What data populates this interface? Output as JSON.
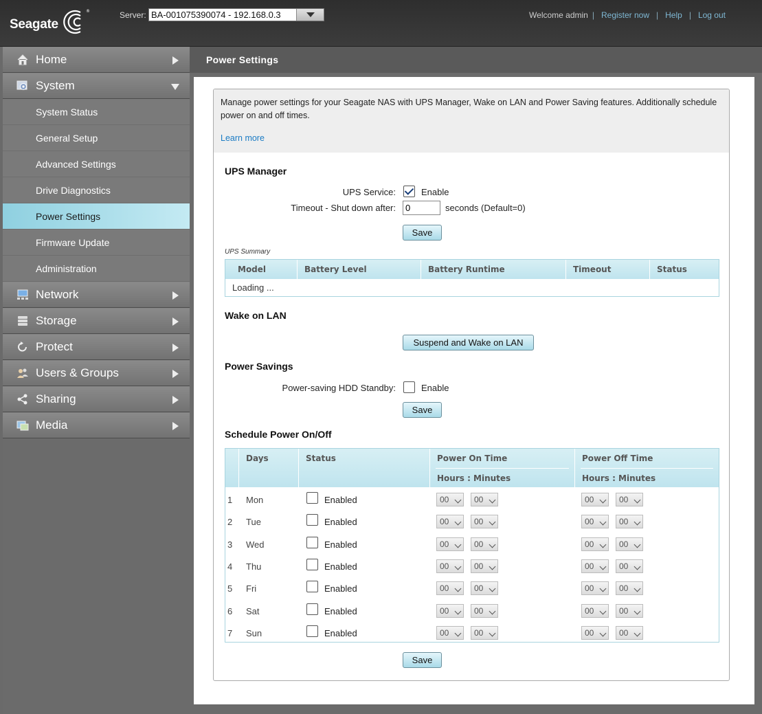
{
  "header": {
    "brand": "Seagate",
    "server_label": "Server:",
    "server_value": "BA-001075390074 - 192.168.0.3",
    "welcome": "Welcome admin",
    "links": [
      "Register now",
      "Help",
      "Log out"
    ]
  },
  "sidebar": {
    "items": [
      {
        "label": "Home",
        "icon": "home-icon"
      },
      {
        "label": "System",
        "icon": "system-icon",
        "expanded": true,
        "sub": [
          "System Status",
          "General Setup",
          "Advanced Settings",
          "Drive Diagnostics",
          "Power Settings",
          "Firmware Update",
          "Administration"
        ]
      },
      {
        "label": "Network",
        "icon": "network-icon"
      },
      {
        "label": "Storage",
        "icon": "storage-icon"
      },
      {
        "label": "Protect",
        "icon": "protect-icon"
      },
      {
        "label": "Users & Groups",
        "icon": "users-icon"
      },
      {
        "label": "Sharing",
        "icon": "sharing-icon"
      },
      {
        "label": "Media",
        "icon": "media-icon"
      }
    ],
    "active_sub": "Power Settings"
  },
  "page": {
    "title": "Power Settings",
    "intro": "Manage power settings for your Seagate NAS with UPS Manager, Wake on LAN and Power Saving features. Additionally schedule power on and off times.",
    "learn_more": "Learn more"
  },
  "ups": {
    "title": "UPS Manager",
    "service_label": "UPS Service:",
    "service_enabled": true,
    "enable_label": "Enable",
    "timeout_label": "Timeout - Shut down after:",
    "timeout_value": "0",
    "timeout_suffix": "seconds (Default=0)",
    "save_label": "Save",
    "summary_label": "UPS Summary",
    "columns": [
      "Model",
      "Battery Level",
      "Battery Runtime",
      "Timeout",
      "Status"
    ],
    "loading": "Loading ..."
  },
  "wol": {
    "title": "Wake on LAN",
    "button_label": "Suspend and Wake on LAN"
  },
  "power_savings": {
    "title": "Power Savings",
    "standby_label": "Power-saving HDD Standby:",
    "enable_label": "Enable",
    "enabled": false,
    "save_label": "Save"
  },
  "schedule": {
    "title": "Schedule Power On/Off",
    "col_days": "Days",
    "col_status": "Status",
    "col_on": "Power On Time",
    "col_off": "Power Off Time",
    "sub_hm": "Hours : Minutes",
    "rows": [
      {
        "num": "1",
        "day": "Mon",
        "enabled_label": "Enabled",
        "on_h": "00",
        "on_m": "00",
        "off_h": "00",
        "off_m": "00"
      },
      {
        "num": "2",
        "day": "Tue",
        "enabled_label": "Enabled",
        "on_h": "00",
        "on_m": "00",
        "off_h": "00",
        "off_m": "00"
      },
      {
        "num": "3",
        "day": "Wed",
        "enabled_label": "Enabled",
        "on_h": "00",
        "on_m": "00",
        "off_h": "00",
        "off_m": "00"
      },
      {
        "num": "4",
        "day": "Thu",
        "enabled_label": "Enabled",
        "on_h": "00",
        "on_m": "00",
        "off_h": "00",
        "off_m": "00"
      },
      {
        "num": "5",
        "day": "Fri",
        "enabled_label": "Enabled",
        "on_h": "00",
        "on_m": "00",
        "off_h": "00",
        "off_m": "00"
      },
      {
        "num": "6",
        "day": "Sat",
        "enabled_label": "Enabled",
        "on_h": "00",
        "on_m": "00",
        "off_h": "00",
        "off_m": "00"
      },
      {
        "num": "7",
        "day": "Sun",
        "enabled_label": "Enabled",
        "on_h": "00",
        "on_m": "00",
        "off_h": "00",
        "off_m": "00"
      }
    ],
    "save_label": "Save"
  },
  "colors": {
    "accent": "#8fd0e0",
    "link": "#1a7bc4",
    "table_header": "#bfe4ee"
  }
}
